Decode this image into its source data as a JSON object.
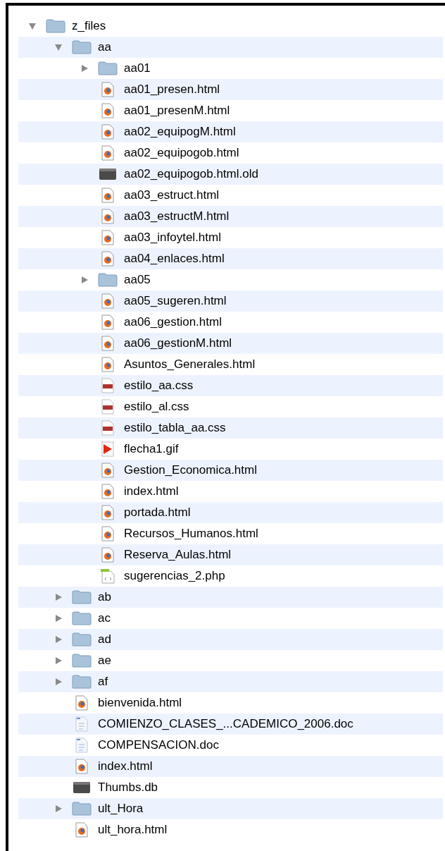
{
  "tree": [
    {
      "name": "z_files",
      "kind": "folder",
      "expanded": true,
      "children": [
        {
          "name": "aa",
          "kind": "folder",
          "expanded": true,
          "children": [
            {
              "name": "aa01",
              "kind": "folder",
              "expanded": false
            },
            {
              "name": "aa01_presen.html",
              "kind": "html"
            },
            {
              "name": "aa01_presenM.html",
              "kind": "html"
            },
            {
              "name": "aa02_equipogM.html",
              "kind": "html"
            },
            {
              "name": "aa02_equipogob.html",
              "kind": "html"
            },
            {
              "name": "aa02_equipogob.html.old",
              "kind": "binary"
            },
            {
              "name": "aa03_estruct.html",
              "kind": "html"
            },
            {
              "name": "aa03_estructM.html",
              "kind": "html"
            },
            {
              "name": "aa03_infoytel.html",
              "kind": "html"
            },
            {
              "name": "aa04_enlaces.html",
              "kind": "html"
            },
            {
              "name": "aa05",
              "kind": "folder",
              "expanded": false
            },
            {
              "name": "aa05_sugeren.html",
              "kind": "html"
            },
            {
              "name": "aa06_gestion.html",
              "kind": "html"
            },
            {
              "name": "aa06_gestionM.html",
              "kind": "html"
            },
            {
              "name": "Asuntos_Generales.html",
              "kind": "html"
            },
            {
              "name": "estilo_aa.css",
              "kind": "css"
            },
            {
              "name": "estilo_al.css",
              "kind": "css"
            },
            {
              "name": "estilo_tabla_aa.css",
              "kind": "css"
            },
            {
              "name": "flecha1.gif",
              "kind": "gif"
            },
            {
              "name": "Gestion_Economica.html",
              "kind": "html"
            },
            {
              "name": "index.html",
              "kind": "html"
            },
            {
              "name": "portada.html",
              "kind": "html"
            },
            {
              "name": "Recursos_Humanos.html",
              "kind": "html"
            },
            {
              "name": "Reserva_Aulas.html",
              "kind": "html"
            },
            {
              "name": "sugerencias_2.php",
              "kind": "php"
            }
          ]
        },
        {
          "name": "ab",
          "kind": "folder",
          "expanded": false
        },
        {
          "name": "ac",
          "kind": "folder",
          "expanded": false
        },
        {
          "name": "ad",
          "kind": "folder",
          "expanded": false
        },
        {
          "name": "ae",
          "kind": "folder",
          "expanded": false
        },
        {
          "name": "af",
          "kind": "folder",
          "expanded": false
        },
        {
          "name": "bienvenida.html",
          "kind": "html"
        },
        {
          "name": "COMIENZO_CLASES_...CADEMICO_2006.doc",
          "kind": "doc"
        },
        {
          "name": "COMPENSACION.doc",
          "kind": "doc"
        },
        {
          "name": "index.html",
          "kind": "html"
        },
        {
          "name": "Thumbs.db",
          "kind": "binary"
        },
        {
          "name": "ult_Hora",
          "kind": "folder",
          "expanded": false
        },
        {
          "name": "ult_hora.html",
          "kind": "html"
        }
      ]
    }
  ]
}
